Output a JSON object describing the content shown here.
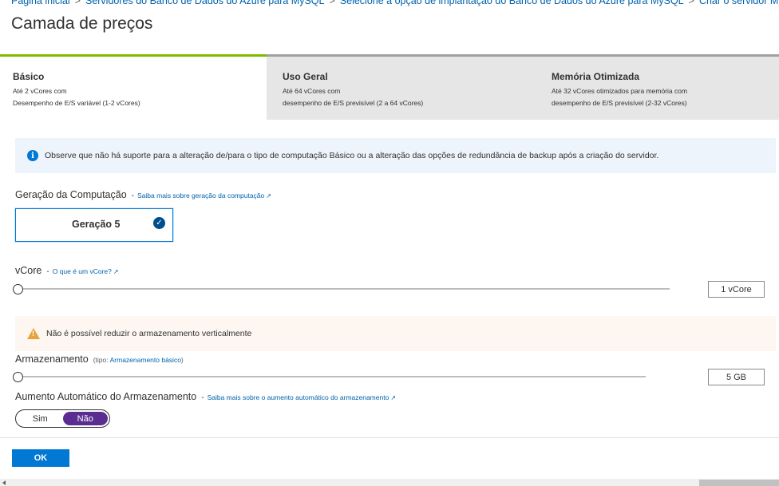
{
  "breadcrumb": [
    {
      "label": "Página inicial"
    },
    {
      "label": "Servidores do Banco de Dados do Azure para MySQL"
    },
    {
      "label": "Selecione a opção de implantação do Banco de Dados do Azure para MySQL"
    },
    {
      "label": "Criar o servidor MySQL"
    }
  ],
  "breadcrumb_separator": ">",
  "page_title": "Camada de preços",
  "tiers": [
    {
      "name": "Básico",
      "desc1": "Até 2 vCores com",
      "desc2": "Desempenho de E/S variável (1-2 vCores)",
      "selected": true
    },
    {
      "name": "Uso Geral",
      "desc1": "Até 64 vCores com",
      "desc2": "desempenho de E/S previsível (2 a 64 vCores)",
      "selected": false
    },
    {
      "name": "Memória Otimizada",
      "desc1": "Até 32 vCores otimizados para memória com",
      "desc2": "desempenho de E/S previsível (2-32 vCores)",
      "selected": false
    }
  ],
  "info": {
    "icon": "info-icon",
    "text": "Observe que não há suporte para a alteração de/para o tipo de computação Básico ou a alteração das opções de redundância de backup após a criação do servidor."
  },
  "compute_generation": {
    "label": "Geração da Computação",
    "dash": "-",
    "link": "Saiba mais sobre geração da computação",
    "option": "Geração 5",
    "selected": true
  },
  "vcore": {
    "label": "vCore",
    "dash": "-",
    "link": "O que é um vCore?",
    "value": "1 vCore",
    "slider_level": 0
  },
  "warning": {
    "icon": "warning-icon",
    "text": "Não é possível reduzir o armazenamento verticalmente"
  },
  "storage": {
    "label": "Armazenamento",
    "type_prefix": "(tipo:",
    "type_link": "Armazenamento básico",
    "type_suffix": ")",
    "value": "5 GB",
    "slider_level": 0
  },
  "auto_grow": {
    "label": "Aumento Automático do Armazenamento",
    "dash": "-",
    "link": "Saiba mais sobre o aumento automático do armazenamento",
    "options": [
      "Sim",
      "Não"
    ],
    "selected": "Não"
  },
  "ok_button": "OK",
  "colors": {
    "accent": "#0078d4",
    "selected_tier_bar": "#7fba00",
    "toggle_on": "#5c2d91",
    "warning": "#e8a33d"
  }
}
